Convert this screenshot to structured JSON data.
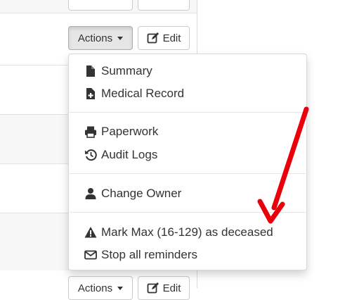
{
  "row_actions": {
    "actions_label": "Actions",
    "edit_label": "Edit"
  },
  "menu": {
    "items": [
      {
        "label": "Summary",
        "icon": "file-icon"
      },
      {
        "label": "Medical Record",
        "icon": "medical-file-icon"
      },
      {
        "label": "Paperwork",
        "icon": "print-icon"
      },
      {
        "label": "Audit Logs",
        "icon": "history-icon"
      },
      {
        "label": "Change Owner",
        "icon": "user-icon"
      },
      {
        "label": "Mark Max (16-129) as deceased",
        "icon": "warning-icon"
      },
      {
        "label": "Stop all reminders",
        "icon": "envelope-icon"
      }
    ]
  },
  "colors": {
    "annotation_arrow": "#e8000b",
    "button_border": "#cccccc",
    "menu_border": "#d0d0d0"
  }
}
